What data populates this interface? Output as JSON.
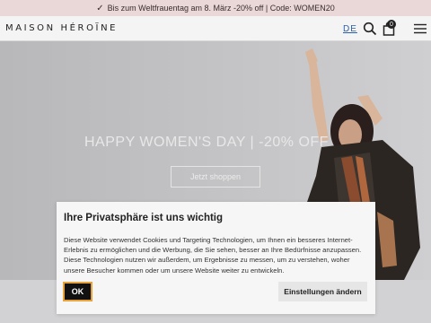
{
  "promo": {
    "text": "Bis zum Weltfrauentag am 8. März -20% off | Code: WOMEN20"
  },
  "header": {
    "logo": "MAISON HÉROÏNE",
    "language": "DE",
    "cart_count": "0"
  },
  "hero": {
    "title": "HAPPY WOMEN'S DAY | -20% OFF",
    "button": "Jetzt shoppen"
  },
  "cookie": {
    "title": "Ihre Privatsphäre ist uns wichtig",
    "text": "Diese Website verwendet Cookies und Targeting Technologien, um Ihnen ein besseres Internet-Erlebnis zu ermöglichen und die Werbung, die Sie sehen, besser an Ihre Bedürfnisse anzupassen. Diese Technologien nutzen wir außerdem, um Ergebnisse zu messen, um zu verstehen, woher unsere Besucher kommen oder um unsere Website weiter zu entwickeln.",
    "ok_label": "OK",
    "settings_label": "Einstellungen ändern"
  },
  "icons": {
    "promo": "check-icon",
    "search": "search-icon",
    "bag": "bag-icon",
    "menu": "menu-icon"
  }
}
